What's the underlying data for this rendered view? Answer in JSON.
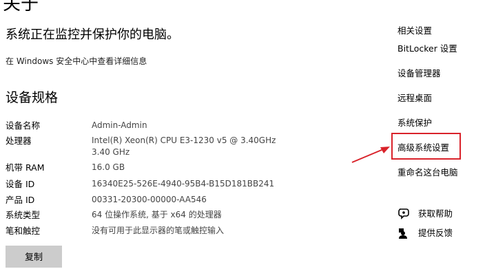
{
  "page": {
    "title": "关于"
  },
  "security": {
    "status": "系统正在监控并保护你的电脑。",
    "link": "在 Windows 安全中心中查看详细信息"
  },
  "specs": {
    "heading": "设备规格",
    "rows": [
      {
        "label": "设备名称",
        "value": "Admin-Admin"
      },
      {
        "label": "处理器",
        "value": "Intel(R) Xeon(R) CPU E3-1230 v5 @ 3.40GHz   3.40 GHz"
      },
      {
        "label": "机带 RAM",
        "value": "16.0 GB"
      },
      {
        "label": "设备 ID",
        "value": "16340E25-526E-4940-95B4-B15D181BB241"
      },
      {
        "label": "产品 ID",
        "value": "00331-20300-00000-AA546"
      },
      {
        "label": "系统类型",
        "value": "64 位操作系统, 基于 x64 的处理器"
      },
      {
        "label": "笔和触控",
        "value": "没有可用于此显示器的笔或触控输入"
      }
    ],
    "copy_label": "复制"
  },
  "related": {
    "heading": "相关设置",
    "links": [
      "BitLocker 设置",
      "设备管理器",
      "远程桌面",
      "系统保护",
      "高级系统设置",
      "重命名这台电脑"
    ]
  },
  "help": {
    "get_help": "获取帮助",
    "feedback": "提供反馈"
  },
  "colors": {
    "highlight": "#d9222a",
    "button_bg": "#cccccc"
  },
  "icons": {
    "get_help": "help-chat-icon",
    "feedback": "feedback-person-icon"
  }
}
